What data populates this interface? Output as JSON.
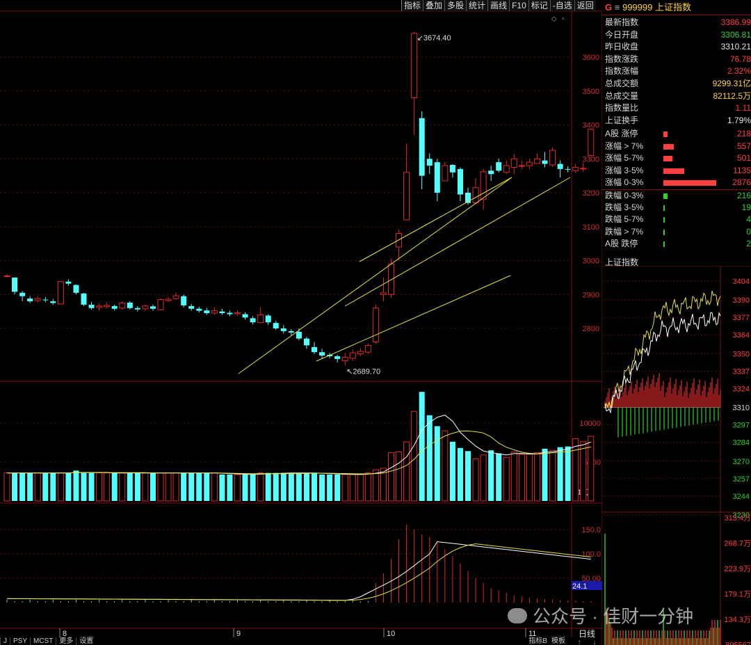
{
  "toolbar": [
    "指标",
    "叠加",
    "多股",
    "统计",
    "画线",
    "F10",
    "标记",
    "-自选",
    "返回"
  ],
  "header": {
    "prefix": "G",
    "eq": "≡",
    "code": "999999",
    "name": "上证指数"
  },
  "info": [
    {
      "label": "最新指数",
      "value": "3386.99",
      "color": "#ff4040"
    },
    {
      "label": "今日开盘",
      "value": "3306.81",
      "color": "#3ccf3c"
    },
    {
      "label": "昨日收盘",
      "value": "3310.21",
      "color": "#e6e6e6"
    },
    {
      "label": "指数涨跌",
      "value": "76.78",
      "color": "#ff4040"
    },
    {
      "label": "指数涨幅",
      "value": "2.32%",
      "color": "#ff4040"
    },
    {
      "label": "总成交额",
      "value": "9299.31亿",
      "color": "#ffd23a"
    },
    {
      "label": "总成交量",
      "value": "82112.5万",
      "color": "#ffd23a"
    },
    {
      "label": "指数量比",
      "value": "1.11",
      "color": "#ff4040"
    },
    {
      "label": "上证换手",
      "value": "1.79%",
      "color": "#e6e6e6"
    }
  ],
  "stats": [
    {
      "label": "A股 涨停",
      "value": "218",
      "count": 218,
      "color": "#ff4040"
    },
    {
      "label": "涨幅 > 7%",
      "value": "557",
      "count": 557,
      "color": "#ff4040"
    },
    {
      "label": "涨幅 5-7%",
      "value": "501",
      "count": 501,
      "color": "#ff4040"
    },
    {
      "label": "涨幅 3-5%",
      "value": "1135",
      "count": 1135,
      "color": "#ff4040"
    },
    {
      "label": "涨幅 0-3%",
      "value": "2876",
      "count": 2876,
      "color": "#ff4040"
    },
    {
      "label": "跌幅 0-3%",
      "value": "216",
      "count": 216,
      "color": "#2fd02f"
    },
    {
      "label": "跌幅 3-5%",
      "value": "19",
      "count": 19,
      "color": "#2fd02f"
    },
    {
      "label": "跌幅 5-7%",
      "value": "4",
      "count": 4,
      "color": "#2fd02f"
    },
    {
      "label": "跌幅 > 7%",
      "value": "0",
      "count": 0,
      "color": "#2fd02f"
    },
    {
      "label": "A股 跌停",
      "value": "2",
      "count": 2,
      "color": "#2fd02f"
    }
  ],
  "mini_title": "上证指数",
  "bottom_tabs": [
    "J",
    "PSY",
    "MCST",
    "更多",
    "设置"
  ],
  "bottom_right": [
    "指标B",
    "模板"
  ],
  "day_button": "日线",
  "day_arrows": [
    "↑",
    "↓"
  ],
  "watermark": "公众号 · 佳财一分钟",
  "chart_data": {
    "type": "candlestick",
    "kline_labels": {
      "high": "3674.40",
      "low": "2689.70"
    },
    "price_axis": [
      2800,
      2900,
      3000,
      3100,
      3200,
      3300,
      3400,
      3500,
      3600
    ],
    "volume_axis": [
      "5000",
      "10000"
    ],
    "volume_unit": "X10万",
    "macd_axis": [
      "50.00",
      "100.0",
      "150.0"
    ],
    "macd_badge": "24.1",
    "month_labels": [
      "8",
      "9",
      "10",
      "11"
    ],
    "candles": [
      {
        "o": 2955,
        "c": 2955,
        "h": 2960,
        "l": 2950
      },
      {
        "o": 2950,
        "c": 2908,
        "h": 2950,
        "l": 2900
      },
      {
        "o": 2905,
        "c": 2895,
        "h": 2910,
        "l": 2880
      },
      {
        "o": 2888,
        "c": 2880,
        "h": 2895,
        "l": 2875
      },
      {
        "o": 2882,
        "c": 2888,
        "h": 2895,
        "l": 2876
      },
      {
        "o": 2885,
        "c": 2883,
        "h": 2892,
        "l": 2877
      },
      {
        "o": 2880,
        "c": 2875,
        "h": 2887,
        "l": 2870
      },
      {
        "o": 2872,
        "c": 2938,
        "h": 2940,
        "l": 2870
      },
      {
        "o": 2938,
        "c": 2932,
        "h": 2945,
        "l": 2926
      },
      {
        "o": 2928,
        "c": 2905,
        "h": 2930,
        "l": 2900
      },
      {
        "o": 2903,
        "c": 2870,
        "h": 2905,
        "l": 2866
      },
      {
        "o": 2870,
        "c": 2860,
        "h": 2878,
        "l": 2855
      },
      {
        "o": 2862,
        "c": 2866,
        "h": 2874,
        "l": 2852
      },
      {
        "o": 2864,
        "c": 2868,
        "h": 2876,
        "l": 2858
      },
      {
        "o": 2866,
        "c": 2858,
        "h": 2870,
        "l": 2852
      },
      {
        "o": 2860,
        "c": 2875,
        "h": 2880,
        "l": 2856
      },
      {
        "o": 2876,
        "c": 2860,
        "h": 2880,
        "l": 2856
      },
      {
        "o": 2860,
        "c": 2856,
        "h": 2866,
        "l": 2850
      },
      {
        "o": 2858,
        "c": 2866,
        "h": 2870,
        "l": 2852
      },
      {
        "o": 2865,
        "c": 2858,
        "h": 2870,
        "l": 2852
      },
      {
        "o": 2855,
        "c": 2885,
        "h": 2888,
        "l": 2853
      },
      {
        "o": 2882,
        "c": 2886,
        "h": 2892,
        "l": 2878
      },
      {
        "o": 2888,
        "c": 2896,
        "h": 2906,
        "l": 2884
      },
      {
        "o": 2895,
        "c": 2868,
        "h": 2900,
        "l": 2862
      },
      {
        "o": 2866,
        "c": 2858,
        "h": 2872,
        "l": 2852
      },
      {
        "o": 2858,
        "c": 2852,
        "h": 2864,
        "l": 2847
      },
      {
        "o": 2853,
        "c": 2845,
        "h": 2860,
        "l": 2840
      },
      {
        "o": 2845,
        "c": 2852,
        "h": 2862,
        "l": 2840
      },
      {
        "o": 2850,
        "c": 2845,
        "h": 2858,
        "l": 2840
      },
      {
        "o": 2846,
        "c": 2842,
        "h": 2852,
        "l": 2836
      },
      {
        "o": 2843,
        "c": 2846,
        "h": 2853,
        "l": 2838
      },
      {
        "o": 2842,
        "c": 2832,
        "h": 2848,
        "l": 2826
      },
      {
        "o": 2830,
        "c": 2818,
        "h": 2836,
        "l": 2812
      },
      {
        "o": 2817,
        "c": 2840,
        "h": 2862,
        "l": 2815
      },
      {
        "o": 2838,
        "c": 2818,
        "h": 2842,
        "l": 2810
      },
      {
        "o": 2816,
        "c": 2800,
        "h": 2822,
        "l": 2796
      },
      {
        "o": 2800,
        "c": 2792,
        "h": 2810,
        "l": 2785
      },
      {
        "o": 2792,
        "c": 2788,
        "h": 2798,
        "l": 2780
      },
      {
        "o": 2790,
        "c": 2770,
        "h": 2800,
        "l": 2765
      },
      {
        "o": 2770,
        "c": 2750,
        "h": 2775,
        "l": 2740
      },
      {
        "o": 2745,
        "c": 2730,
        "h": 2760,
        "l": 2725
      },
      {
        "o": 2730,
        "c": 2720,
        "h": 2740,
        "l": 2712
      },
      {
        "o": 2722,
        "c": 2718,
        "h": 2728,
        "l": 2712
      },
      {
        "o": 2718,
        "c": 2710,
        "h": 2722,
        "l": 2700
      },
      {
        "o": 2705,
        "c": 2715,
        "h": 2728,
        "l": 2690
      },
      {
        "o": 2712,
        "c": 2728,
        "h": 2738,
        "l": 2705
      },
      {
        "o": 2725,
        "c": 2732,
        "h": 2742,
        "l": 2718
      },
      {
        "o": 2730,
        "c": 2750,
        "h": 2756,
        "l": 2725
      },
      {
        "o": 2760,
        "c": 2860,
        "h": 2870,
        "l": 2755
      },
      {
        "o": 2900,
        "c": 2905,
        "h": 2950,
        "l": 2880
      },
      {
        "o": 2900,
        "c": 2990,
        "h": 3005,
        "l": 2890
      },
      {
        "o": 3040,
        "c": 3080,
        "h": 3090,
        "l": 3000
      },
      {
        "o": 3120,
        "c": 3260,
        "h": 3345,
        "l": 3155
      },
      {
        "o": 3480,
        "c": 3670,
        "h": 3674,
        "l": 3370
      },
      {
        "o": 3420,
        "c": 3250,
        "h": 3440,
        "l": 3210
      },
      {
        "o": 3300,
        "c": 3280,
        "h": 3316,
        "l": 3255
      },
      {
        "o": 3290,
        "c": 3200,
        "h": 3300,
        "l": 3175
      },
      {
        "o": 3235,
        "c": 3280,
        "h": 3290,
        "l": 3235
      },
      {
        "o": 3282,
        "c": 3260,
        "h": 3284,
        "l": 3245
      },
      {
        "o": 3270,
        "c": 3195,
        "h": 3275,
        "l": 3175
      },
      {
        "o": 3200,
        "c": 3170,
        "h": 3215,
        "l": 3165
      },
      {
        "o": 3170,
        "c": 3215,
        "h": 3243,
        "l": 3165
      },
      {
        "o": 3180,
        "c": 3262,
        "h": 3270,
        "l": 3150
      },
      {
        "o": 3265,
        "c": 3255,
        "h": 3280,
        "l": 3235
      },
      {
        "o": 3290,
        "c": 3265,
        "h": 3301,
        "l": 3260
      },
      {
        "o": 3260,
        "c": 3280,
        "h": 3295,
        "l": 3255
      },
      {
        "o": 3275,
        "c": 3300,
        "h": 3314,
        "l": 3255
      },
      {
        "o": 3280,
        "c": 3280,
        "h": 3295,
        "l": 3270
      },
      {
        "o": 3280,
        "c": 3290,
        "h": 3300,
        "l": 3270
      },
      {
        "o": 3286,
        "c": 3300,
        "h": 3316,
        "l": 3285
      },
      {
        "o": 3295,
        "c": 3285,
        "h": 3320,
        "l": 3275
      },
      {
        "o": 3282,
        "c": 3325,
        "h": 3333,
        "l": 3276
      },
      {
        "o": 3285,
        "c": 3270,
        "h": 3295,
        "l": 3245
      },
      {
        "o": 3270,
        "c": 3268,
        "h": 3278,
        "l": 3260
      },
      {
        "o": 3265,
        "c": 3275,
        "h": 3285,
        "l": 3258
      },
      {
        "o": 3270,
        "c": 3272,
        "h": 3289,
        "l": 3262
      },
      {
        "o": 3310,
        "c": 3387,
        "h": 3390,
        "l": 3306
      }
    ],
    "volumes": [
      3600,
      3600,
      3600,
      3600,
      3600,
      3600,
      3600,
      3600,
      3600,
      3900,
      3600,
      3600,
      3600,
      3600,
      3600,
      3600,
      3600,
      3600,
      3600,
      3600,
      3600,
      3600,
      3600,
      3600,
      3600,
      3600,
      3600,
      3600,
      3400,
      3400,
      3400,
      3400,
      3400,
      3600,
      3600,
      3600,
      3600,
      3600,
      3600,
      3600,
      3600,
      3400,
      3400,
      3400,
      3400,
      3400,
      3400,
      3600,
      4000,
      4200,
      6200,
      6300,
      7600,
      11500,
      14000,
      11000,
      9600,
      9000,
      7600,
      6800,
      6400,
      5400,
      5900,
      6500,
      6100,
      5600,
      6300,
      6000,
      6100,
      6200,
      6700,
      6500,
      6900,
      7000,
      8000,
      7600,
      8300
    ]
  }
}
